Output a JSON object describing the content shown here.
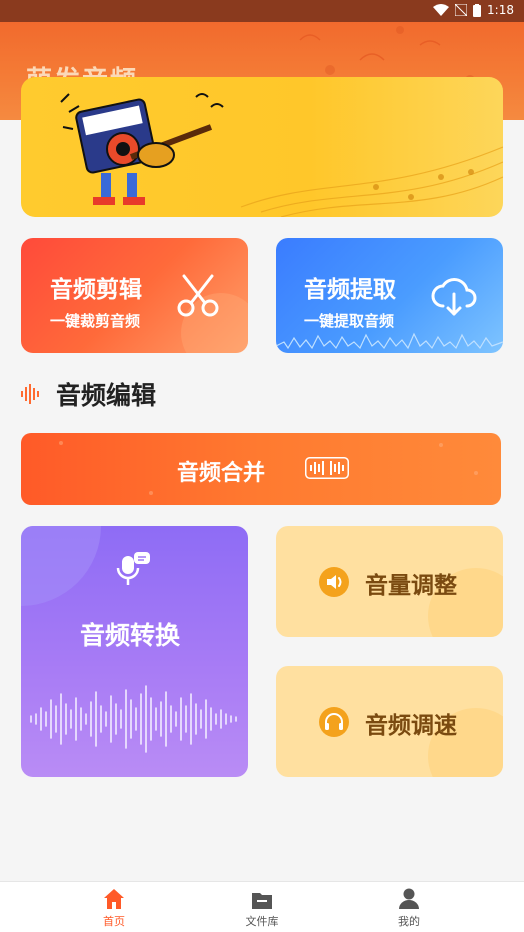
{
  "status": {
    "time": "1:18"
  },
  "app": {
    "title": "萌发音频"
  },
  "cards": {
    "cut": {
      "title": "音频剪辑",
      "subtitle": "一键裁剪音频"
    },
    "extract": {
      "title": "音频提取",
      "subtitle": "一键提取音频"
    }
  },
  "section": {
    "title": "音频编辑"
  },
  "tools": {
    "merge": "音频合并",
    "convert": "音频转换",
    "volume": "音量调整",
    "speed": "音频调速"
  },
  "tabs": [
    {
      "label": "首页",
      "icon": "home-icon",
      "active": true
    },
    {
      "label": "文件库",
      "icon": "folder-icon",
      "active": false
    },
    {
      "label": "我的",
      "icon": "user-icon",
      "active": false
    }
  ],
  "colors": {
    "accent": "#ff5a28",
    "tabInactive": "#555555",
    "tabActive": "#ff5a28"
  }
}
